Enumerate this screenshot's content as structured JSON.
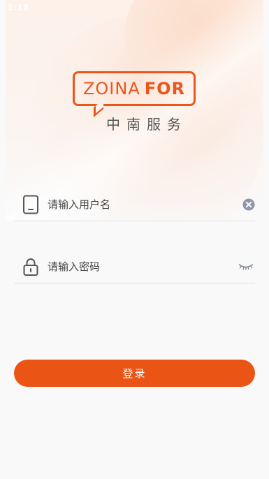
{
  "status_bar": {
    "time": "3:18"
  },
  "logo": {
    "brand_light": "ZOINA",
    "brand_bold": "FOR",
    "subtitle": "中南服务"
  },
  "form": {
    "username": {
      "placeholder": "请输入用户名",
      "value": ""
    },
    "password": {
      "placeholder": "请输入密码",
      "value": ""
    },
    "login_label": "登录"
  },
  "colors": {
    "accent": "#ea5415",
    "icon_gray": "#555555",
    "clear_icon": "#8f97a8"
  },
  "icons": {
    "username": "phone-icon",
    "username_trailing": "clear-icon",
    "password": "lock-icon",
    "password_trailing": "eye-closed-icon"
  }
}
